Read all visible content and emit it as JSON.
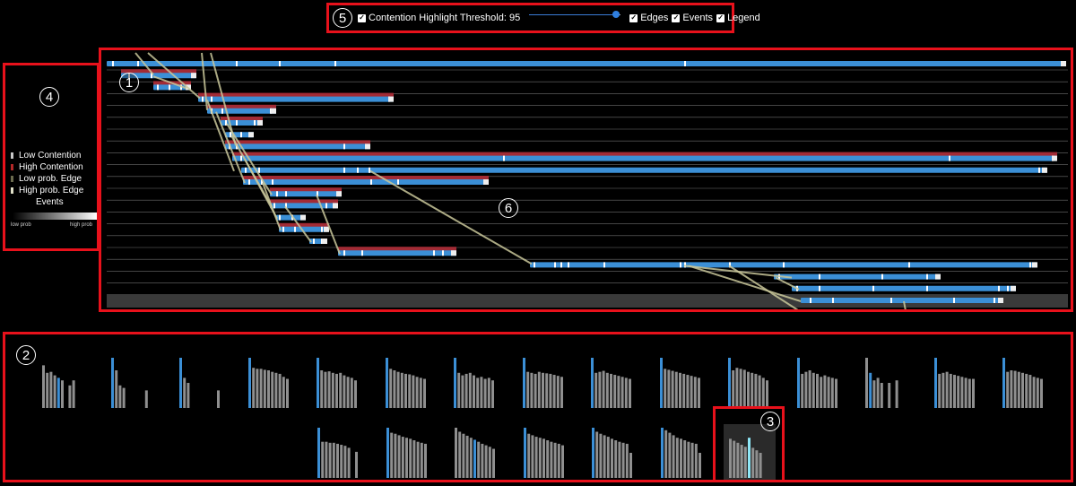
{
  "controls": {
    "marker": "5",
    "threshold_label": "Contention Highlight Threshold:",
    "threshold_value": "95",
    "slider_fraction": 0.95,
    "edges_label": "Edges",
    "events_label": "Events",
    "legend_label": "Legend",
    "checkbox_glyph": "✓"
  },
  "legend": {
    "marker": "4",
    "items": [
      {
        "label": "Low Contention",
        "color": "#c8c8c8"
      },
      {
        "label": "High Contention",
        "color": "#b42828"
      },
      {
        "label": "Low prob. Edge",
        "color": "#6b6b4e"
      },
      {
        "label": "High prob. Edge",
        "color": "#e0e0c8"
      }
    ],
    "events_label": "Events",
    "low_prob": "low prob",
    "high_prob": "high prob"
  },
  "timeline": {
    "marker_rows": "1",
    "marker_edges": "6",
    "colors": {
      "task": "#3b8fd6",
      "contention": "#a22b35",
      "edge": "#c9c79a",
      "row_line": "#8a8a8a"
    }
  },
  "histograms": {
    "marker_panel": "2",
    "marker_selected": "3",
    "colors": {
      "bar": "#8f8f8f",
      "accent": "#3b8fd6",
      "selected_accent": "#8ee7f7"
    }
  }
}
